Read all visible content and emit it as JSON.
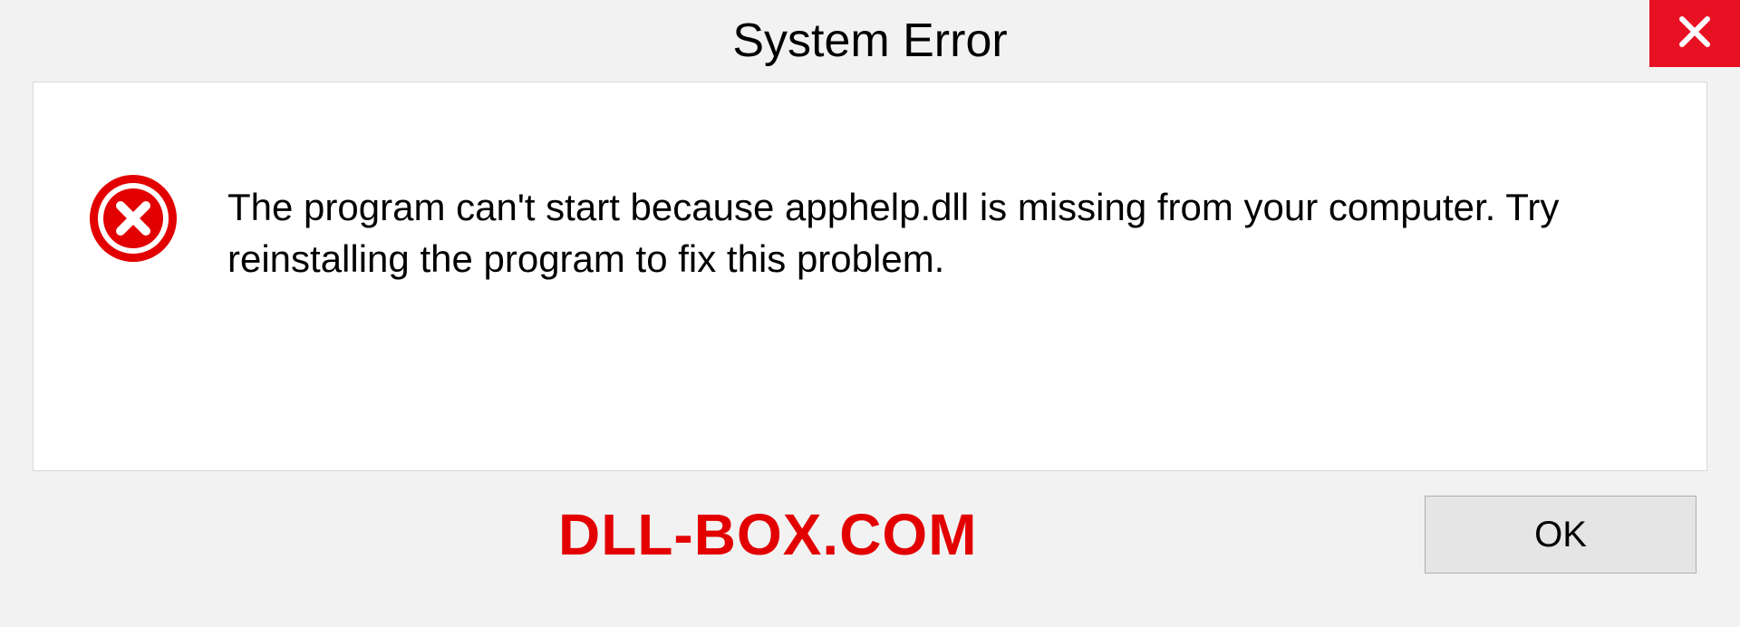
{
  "titlebar": {
    "title": "System Error"
  },
  "message": {
    "text": "The program can't start because apphelp.dll is missing from your computer. Try reinstalling the program to fix this problem."
  },
  "footer": {
    "watermark": "DLL-BOX.COM",
    "ok_label": "OK"
  },
  "colors": {
    "close_red": "#e81123",
    "error_red": "#e20000",
    "panel_bg": "#ffffff",
    "window_bg": "#f2f2f2"
  }
}
